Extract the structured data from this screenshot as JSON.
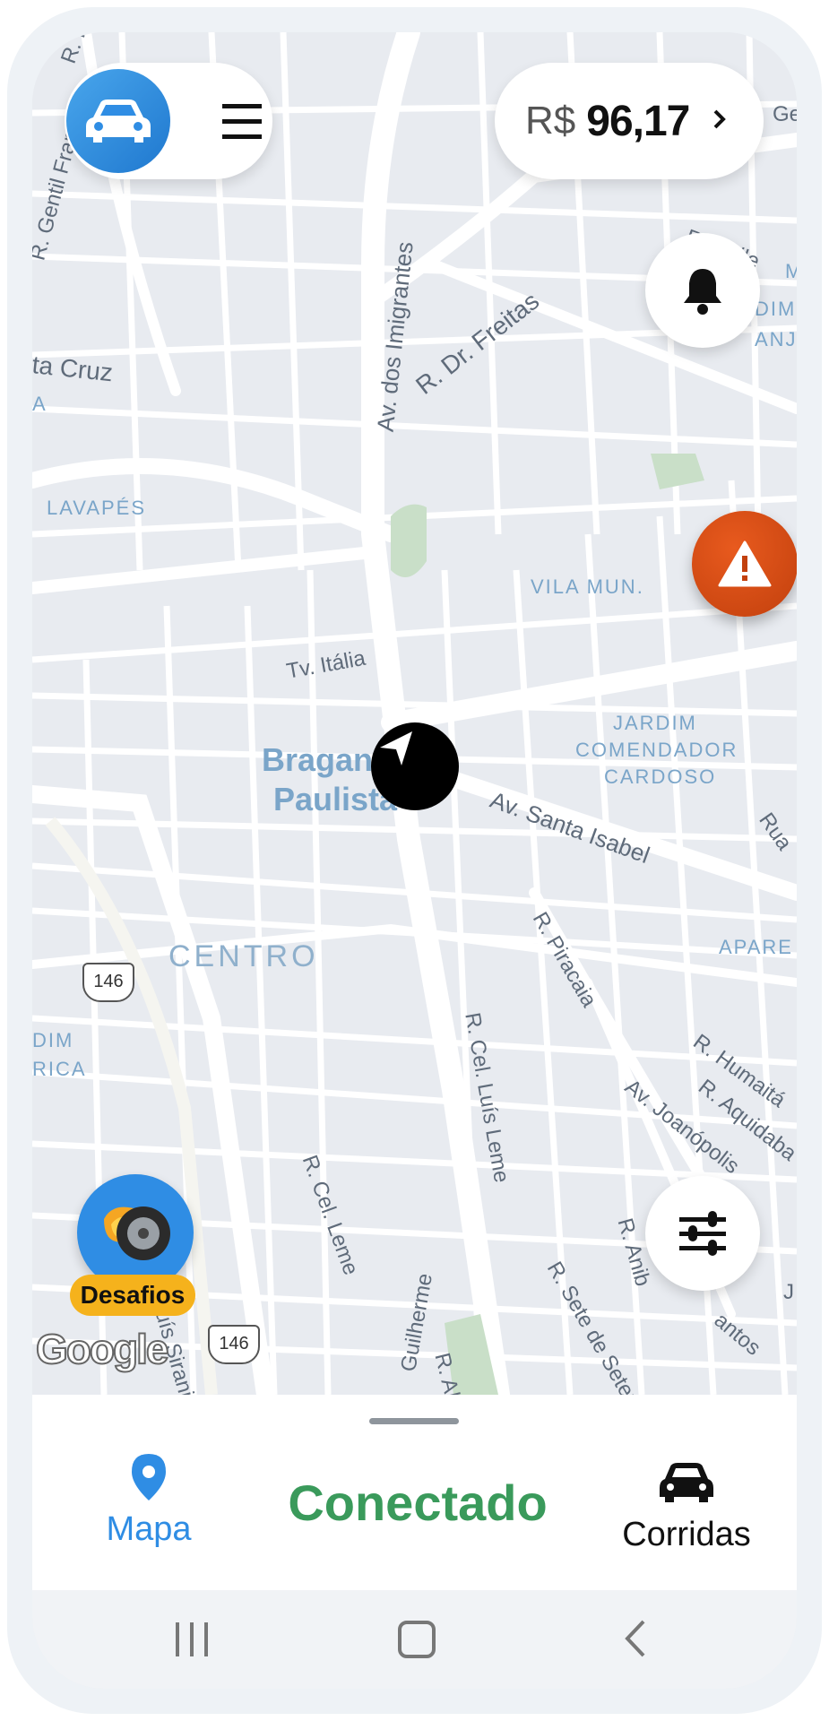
{
  "balance": {
    "currency": "R$",
    "amount": "96,17"
  },
  "map": {
    "labels": [
      "R. Fra",
      "R. Gentil Franco",
      "ta Cruz",
      "A",
      "LAVAPÉS",
      "Av. dos Imigrantes",
      "R. Dr. Freitas",
      "R. Chile",
      "M",
      "DIM",
      "ANJI",
      "VILA MUN.",
      "Tv. Itália",
      "JARDIM",
      "COMENDADOR",
      "CARDOSO",
      "Av. Santa Isabel",
      "Rua",
      "R. Piracaia",
      "R. Cel. Luís Leme",
      "APARE",
      "R. Humaitá",
      "R. Aquidaba",
      "Av. Joanópolis",
      "DIM",
      "RICA",
      "R. Cel. Leme",
      "R. Sete de Setembro",
      "R. Anib",
      "antos",
      "J",
      "R. Albino Dant",
      "Guilherme",
      "R. Luís Sirani",
      "Ge"
    ],
    "city_line1": "Bragança",
    "city_line2": "Paulista",
    "district": "CENTRO",
    "highway": "146",
    "google": "Google"
  },
  "desafios": "Desafios",
  "bottom": {
    "tab_map": "Mapa",
    "status": "Conectado",
    "tab_rides": "Corridas"
  },
  "colors": {
    "accent_blue": "#2f8de4",
    "status_green": "#3a9a5b",
    "alert_orange": "#d9480f"
  },
  "icons": [
    "car-icon",
    "menu-icon",
    "chevron-right-icon",
    "bell-icon",
    "alert-icon",
    "navigation-arrow-icon",
    "filter-sliders-icon",
    "wheel-fire-icon",
    "map-pin-icon",
    "car-front-icon",
    "recent-apps-icon",
    "home-icon",
    "back-icon"
  ]
}
